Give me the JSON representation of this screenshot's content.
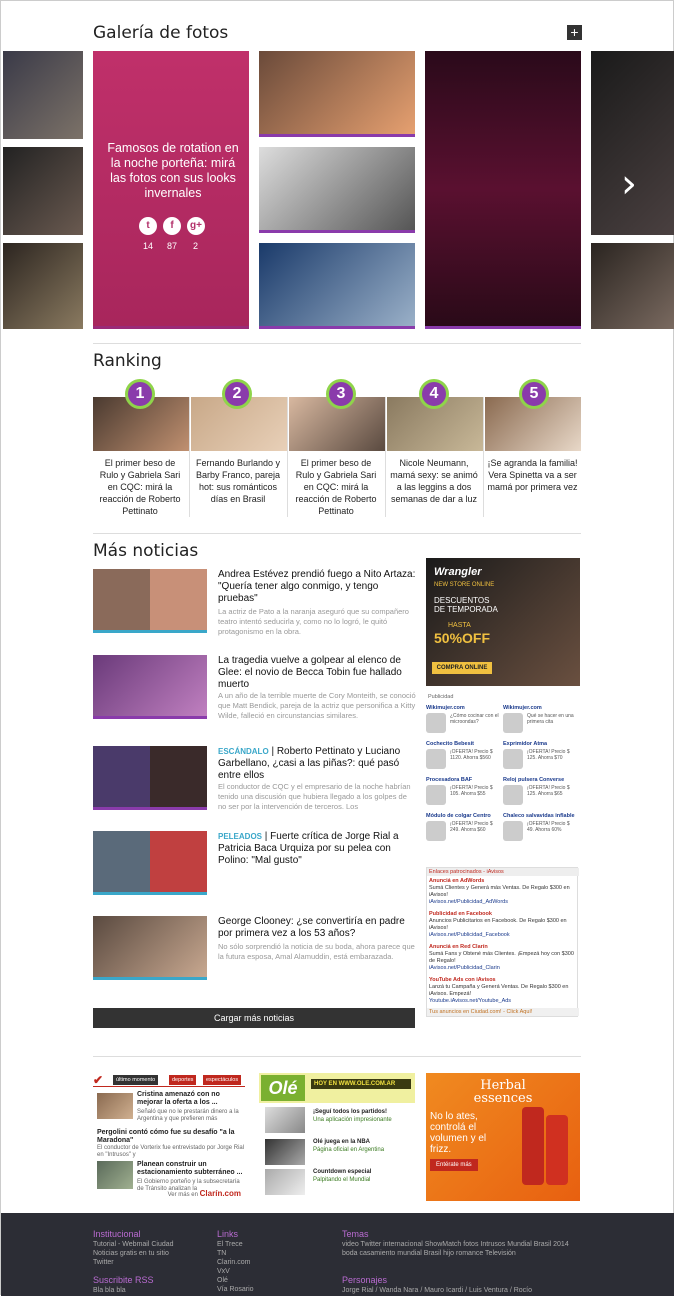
{
  "gallery": {
    "title": "Galería de fotos",
    "plus_icon": "+",
    "feature_caption": "Famosos de rotation en la noche porteña: mirá las fotos con sus looks invernales",
    "share_counts": [
      "14",
      "87",
      "2"
    ],
    "arrow": "›"
  },
  "ranking": {
    "title": "Ranking",
    "items": [
      {
        "num": "1",
        "text": "El primer beso de Rulo y Gabriela Sari en CQC: mirá la reacción de Roberto Pettinato"
      },
      {
        "num": "2",
        "text": "Fernando Burlando y Barby Franco, pareja hot: sus románticos días en Brasil"
      },
      {
        "num": "3",
        "text": "El primer beso de Rulo y Gabriela Sari en CQC: mirá la reacción de Roberto Pettinato"
      },
      {
        "num": "4",
        "text": "Nicole Neumann, mamá sexy: se animó a las leggins a dos semanas de dar a luz"
      },
      {
        "num": "5",
        "text": "¡Se agranda la familia! Vera Spinetta va a ser mamá por primera vez"
      }
    ]
  },
  "news": {
    "title": "Más noticias",
    "items": [
      {
        "tag": "",
        "title": "Andrea Estévez prendió fuego a Nito Artaza: \"Quería tener algo conmigo, y tengo pruebas\"",
        "desc": "La actriz de Pato a la naranja aseguró que su compañero teatro intentó seducirla y, como no lo logró, le quitó protagonismo en la obra."
      },
      {
        "tag": "",
        "title": "La tragedia vuelve a golpear al elenco de Glee: el novio de Becca Tobin fue hallado muerto",
        "desc": "A un año de la terrible muerte de Cory Monteith, se conoció que Matt Bendick, pareja de la actriz que personifica a Kitty Wilde, falleció en circunstancias similares."
      },
      {
        "tag": "ESCÁNDALO",
        "title": "Roberto Pettinato y Luciano Garbellano, ¿casi a las piñas?: qué pasó entre ellos",
        "desc": "El conductor de CQC y el empresario de la noche habrían tenido una discusión que hubiera llegado a los golpes de no ser por la intervención de terceros. Los"
      },
      {
        "tag": "PELEADOS",
        "title": "Fuerte crítica de Jorge Rial a Patricia Baca Urquiza por su pelea con Polino: \"Mal gusto\"",
        "desc": ""
      },
      {
        "tag": "",
        "title": "George Clooney: ¿se convertiría en padre por primera vez a los 53 años?",
        "desc": "No sólo sorprendió la noticia de su boda, ahora parece que la futura esposa, Amal Alamuddin, está embarazada."
      }
    ],
    "load_more": "Cargar más noticias"
  },
  "ads": {
    "wrangler": {
      "brand": "Wrangler",
      "line1": "NEW STORE ONLINE",
      "line2": "DESCUENTOS DE TEMPORADA",
      "line3": "HASTA",
      "line4": "50%OFF",
      "cta": "COMPRA ONLINE"
    },
    "publicidad": "Publicidad",
    "grid": [
      {
        "title": "Wikimujer.com",
        "text": "¿Cómo cocinar con el microondas?"
      },
      {
        "title": "Wikimujer.com",
        "text": "Qué se hacer en una primera cita"
      },
      {
        "title": "Cochecito Bebesit",
        "text": "¡OFERTA! Precio $ 1120. Ahorra $560"
      },
      {
        "title": "Exprimidor Atma",
        "text": "¡OFERTA! Precio $ 125. Ahorra $70"
      },
      {
        "title": "Procesadora BAF",
        "text": "¡OFERTA! Precio $ 105. Ahorra $55"
      },
      {
        "title": "Reloj pulsera Converse",
        "text": "¡OFERTA! Precio $ 125. Ahorra $65"
      },
      {
        "title": "Módulo de colgar Centro",
        "text": "¡OFERTA! Precio $ 249. Ahorra $60"
      },
      {
        "title": "Chaleco salvavidas inflable",
        "text": "¡OFERTA! Precio $ 49. Ahorra 60%"
      }
    ],
    "sponsored_header": "Enlaces patrocinados - iAvisos",
    "sponsored": [
      {
        "title": "Anunciá en AdWords",
        "text": "Sumá Clientes y Generá más Ventas. De Regalo $300 en iAvisos!",
        "url": "iAvisos.net/Publicidad_AdWords"
      },
      {
        "title": "Publicidad en Facebook",
        "text": "Anuncios Publicitarios en Facebook. De Regalo $300 en iAvisos!",
        "url": "iAvisos.net/Publicidad_Facebook"
      },
      {
        "title": "Anunciá en Red Clarín",
        "text": "Sumá Fans y Obtené más Clientes. ¡Empezá hoy con $300 de Regalo!",
        "url": "iAvisos.net/Publicidad_Clarin"
      },
      {
        "title": "YouTube Ads con iAvisos",
        "text": "Lanzá tu Campaña y Generá Ventas. De Regalo $300 en iAvisos. Empezá!",
        "url": "Youtube.iAvisos.net/Youtube_Ads"
      }
    ],
    "sponsored_footer": "Tus anuncios en Ciudad.com! - Click Aquí!"
  },
  "bottom": {
    "clarin_tabs": [
      "último momento",
      "deportes",
      "espectáculos"
    ],
    "clarin_items": [
      {
        "title": "Cristina amenazó con no mejorar la oferta a los ...",
        "desc": "Señaló que no le prestarán dinero a la Argentina y que prefieren más"
      },
      {
        "title": "Pergolini contó cómo fue su desafío \"a la Maradona\"",
        "desc": "El conductor de Vorterix fue entrevistado por Jorge Rial en \"Intrusos\" y"
      },
      {
        "title": "Planean construir un estacionamiento subterráneo ...",
        "desc": "El Gobierno porteño y la subsecretaría de Tránsito analizan la"
      }
    ],
    "clarin_more": "Ver más en",
    "clarin_logo": "Clarín.com",
    "ole_logo": "Olé",
    "ole_header": "HOY EN WWW.OLE.COM.AR",
    "ole_items": [
      {
        "title": "¡Seguí todos los partidos!",
        "desc": "Una aplicación impresionante"
      },
      {
        "title": "Olé juega en la NBA",
        "desc": "Página oficial en Argentina"
      },
      {
        "title": "Countdown especial",
        "desc": "Palpitando el Mundial"
      }
    ],
    "herbal_brand": "Herbal essences",
    "herbal_text": "No lo ates, controlá el volumen y el frizz.",
    "herbal_cta": "Entérate más"
  },
  "footer": {
    "institucional": "Institucional",
    "inst_links": [
      "Tutorial - Webmail Ciudad",
      "Noticias gratis en tu sitio",
      "Twitter"
    ],
    "rss": "Suscribite RSS",
    "rss_links": [
      "Bla bla bla"
    ],
    "links": "Links",
    "links_list": [
      "El Trece",
      "TN",
      "Clarin.com",
      "VxV",
      "Olé",
      "Vía Rosario"
    ],
    "temas": "Temas",
    "temas_text": "video  Twitter  internacional  ShowMatch  fotos  Intrusos  Mundial  Brasil 2014  boda  casamiento  mundial  Brasil  hijo  romance  Televisión",
    "personajes": "Personajes",
    "personajes_text": "Jorge Rial  /  Wanda Nara  /  Mauro Icardi  /  Luis Ventura  /  Rocío"
  },
  "colors": {
    "accent": "#8b3aa8",
    "feature_bg": "#b3306a",
    "badge": "#8a3bab",
    "badge_ring": "#8fd44a",
    "footer_bg": "#2c2d35"
  }
}
